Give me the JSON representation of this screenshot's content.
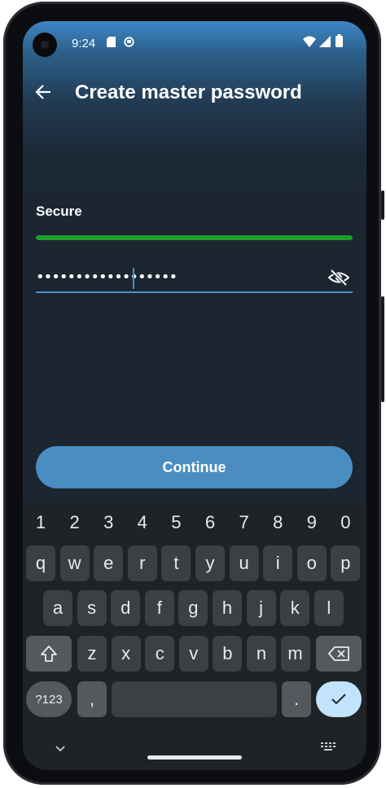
{
  "status_bar": {
    "time": "9:24"
  },
  "toolbar": {
    "title": "Create master password"
  },
  "strength": {
    "label": "Secure",
    "fill_fraction": 1.0,
    "color": "#1e9e2a"
  },
  "password_field": {
    "value": "••••••••••••••••••"
  },
  "continue_label": "Continue",
  "keyboard": {
    "numbers": [
      "1",
      "2",
      "3",
      "4",
      "5",
      "6",
      "7",
      "8",
      "9",
      "0"
    ],
    "row1": [
      "q",
      "w",
      "e",
      "r",
      "t",
      "y",
      "u",
      "i",
      "o",
      "p"
    ],
    "row2": [
      "a",
      "s",
      "d",
      "f",
      "g",
      "h",
      "j",
      "k",
      "l"
    ],
    "row3": [
      "z",
      "x",
      "c",
      "v",
      "b",
      "n",
      "m"
    ],
    "symbols_label": "?123",
    "comma": ",",
    "period": "."
  },
  "colors": {
    "accent": "#4a8dc1",
    "background": "#1b2631"
  }
}
